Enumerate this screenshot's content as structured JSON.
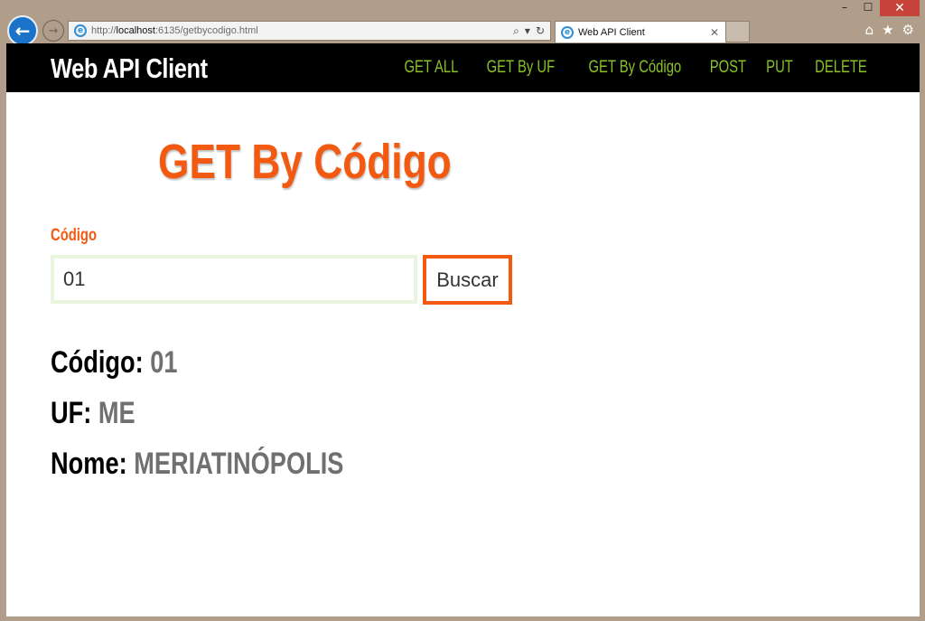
{
  "browser": {
    "url_prefix": "http://",
    "url_host": "localhost",
    "url_rest": ":6135/getbycodigo.html",
    "tab_title": "Web API Client",
    "search_symbol": "⌕",
    "dropdown_symbol": "▾",
    "refresh_symbol": "↻",
    "tab_close_symbol": "✕",
    "back_symbol": "←",
    "forward_symbol": "→",
    "home_symbol": "⌂",
    "favorites_symbol": "★",
    "settings_symbol": "⚙",
    "minimize_symbol": "–",
    "maximize_symbol": "☐",
    "close_symbol": "✕",
    "ie_icon_letter": "e"
  },
  "site": {
    "brand": "Web API Client",
    "menu": [
      {
        "label": "GET ALL"
      },
      {
        "label": "GET By UF"
      },
      {
        "label": "GET By Código"
      },
      {
        "label": "POST"
      },
      {
        "label": "PUT"
      },
      {
        "label": "DELETE"
      }
    ]
  },
  "page": {
    "title": "GET By Código",
    "field_label": "Código",
    "input_value": "01",
    "button_label": "Buscar"
  },
  "results": {
    "codigo_label": "Código:",
    "codigo_value": "01",
    "uf_label": "UF:",
    "uf_value": "ME",
    "nome_label": "Nome:",
    "nome_value": "MERIATINÓPOLIS"
  },
  "colors": {
    "accent": "#f25a12",
    "nav_link": "#8ac126",
    "nav_bg": "#000000",
    "value_gray": "#707070"
  }
}
